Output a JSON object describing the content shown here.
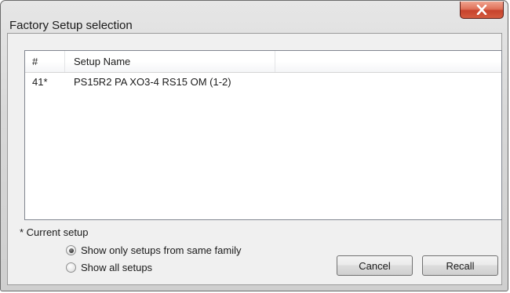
{
  "window": {
    "title": "Factory Setup selection",
    "close_icon": "close-x-icon"
  },
  "list": {
    "columns": [
      "#",
      "Setup Name",
      ""
    ],
    "rows": [
      {
        "num": "41*",
        "name": "PS15R2 PA XO3-4 RS15 OM (1-2)"
      }
    ]
  },
  "footnote": "* Current setup",
  "options": {
    "same_family_label": "Show only setups from same family",
    "all_setups_label": "Show all setups",
    "selected": "same_family"
  },
  "buttons": {
    "cancel_label": "Cancel",
    "recall_label": "Recall"
  },
  "colors": {
    "close_button": "#d45b3f",
    "window_frame": "#d8d8d8",
    "client_bg": "#f0f0f0"
  }
}
